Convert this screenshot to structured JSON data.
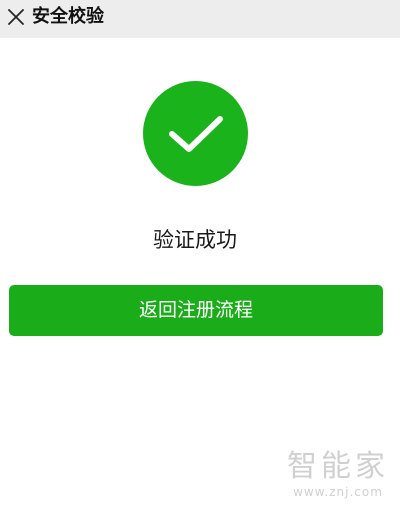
{
  "header": {
    "title": "安全校验",
    "close_icon": "close-icon"
  },
  "main": {
    "status_icon": "checkmark-icon",
    "status_icon_color": "#1bb31b",
    "status_text": "验证成功",
    "return_button_label": "返回注册流程",
    "button_color": "#1aad19"
  },
  "watermark": {
    "logo_text": "智能家",
    "url": "www.znj.com"
  }
}
